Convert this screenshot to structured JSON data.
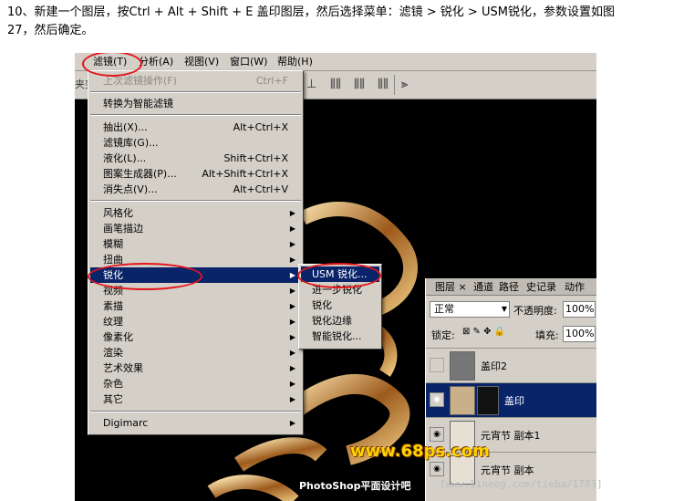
{
  "caption": {
    "line1": "10、新建一个图层，按Ctrl + Alt + Shift + E 盖印图层，然后选择菜单：滤镜 > 锐化 > USM锐化，参数设置如图",
    "line2": "27，然后确定。"
  },
  "menubar": {
    "items": [
      "滤镜(T)",
      "分析(A)",
      "视图(V)",
      "窗口(W)",
      "帮助(H)"
    ]
  },
  "toolbar": {
    "left_text": "夹变",
    "icons": [
      "align-icons"
    ]
  },
  "filter_menu": {
    "last_filter": {
      "label": "上次滤镜操作(F)",
      "shortcut": "Ctrl+F"
    },
    "smart": "转换为智能滤镜",
    "group1": [
      {
        "label": "抽出(X)...",
        "shortcut": "Alt+Ctrl+X"
      },
      {
        "label": "滤镜库(G)...",
        "shortcut": ""
      },
      {
        "label": "液化(L)...",
        "shortcut": "Shift+Ctrl+X"
      },
      {
        "label": "图案生成器(P)...",
        "shortcut": "Alt+Shift+Ctrl+X"
      },
      {
        "label": "消失点(V)...",
        "shortcut": "Alt+Ctrl+V"
      }
    ],
    "group2": [
      "风格化",
      "画笔描边",
      "模糊",
      "扭曲",
      "锐化",
      "视频",
      "素描",
      "纹理",
      "像素化",
      "渲染",
      "艺术效果",
      "杂色",
      "其它"
    ],
    "group3": "Digimarc"
  },
  "sharpen_submenu": [
    "USM 锐化...",
    "进一步锐化",
    "锐化",
    "锐化边缘",
    "智能锐化..."
  ],
  "layers_panel": {
    "tabs": [
      "图层 ×",
      "通道",
      "路径",
      "史记录",
      "动作"
    ],
    "blend_mode": "正常",
    "opacity_label": "不透明度:",
    "opacity_value": "100%",
    "lock_label": "锁定:",
    "fill_label": "填充:",
    "fill_value": "100%",
    "layers": [
      {
        "name": "盖印2",
        "visible": false,
        "active": false
      },
      {
        "name": "盖印",
        "visible": true,
        "active": true
      },
      {
        "name": "元宵节 副本1",
        "visible": true,
        "active": false
      },
      {
        "name": "元宵节 副本",
        "visible": true,
        "active": false
      }
    ]
  },
  "watermarks": {
    "site": "www.68ps.com",
    "brand": "PhotoShop平面设计吧",
    "url": "[www.lineeg.com/tieba/1783]"
  },
  "colors": {
    "menu_bg": "#d4d0c8",
    "selection": "#0a246a",
    "highlight_circle": "#e3161c",
    "watermark": "#ffd200"
  }
}
